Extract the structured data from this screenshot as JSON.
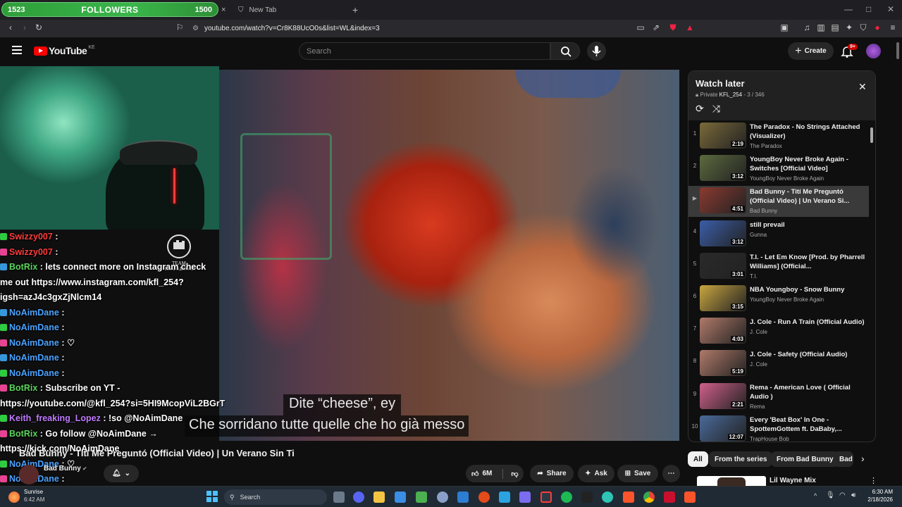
{
  "browser": {
    "followers_overlay": {
      "left_count": "1523",
      "label": "FOLLOWERS",
      "right_count": "1500"
    },
    "tab_new": "New Tab",
    "url": "youtube.com/watch?v=Cr8K88UcO0s&list=WL&index=3"
  },
  "header": {
    "logo_text": "YouTube",
    "logo_region": "KE",
    "search_placeholder": "Search",
    "create_label": "Create",
    "notif_count": "9+"
  },
  "video": {
    "caption_line1": "Dite “cheese”, ey",
    "caption_line2": "Che sorridano tutte quelle che ho già messo",
    "title": "Bad Bunny - Tití Me Preguntó (Official Video) | Un Verano Sin Ti",
    "channel": "Bad Bunny",
    "likes": "6M",
    "share": "Share",
    "ask": "Ask",
    "save": "Save"
  },
  "chat": [
    {
      "user": "Swizzy007",
      "msg": ": ",
      "color": "#ff3b3b"
    },
    {
      "user": "Swizzy007",
      "msg": ": ",
      "color": "#ff3b3b"
    },
    {
      "user": "BotRix",
      "msg": ": lets connect more on Instagram check",
      "color": "#5cd65c"
    },
    {
      "user": "",
      "msg": "me out https://www.instagram.com/kfl_254?",
      "color": "#fff"
    },
    {
      "user": "",
      "msg": "igsh=azJ4c3gxZjNlcm14",
      "color": "#fff"
    },
    {
      "user": "NoAimDane",
      "msg": ": ",
      "color": "#4aa3ff"
    },
    {
      "user": "NoAimDane",
      "msg": ": ",
      "color": "#4aa3ff"
    },
    {
      "user": "NoAimDane",
      "msg": ": ♡",
      "color": "#4aa3ff"
    },
    {
      "user": "NoAimDane",
      "msg": ": ",
      "color": "#4aa3ff"
    },
    {
      "user": "NoAimDane",
      "msg": ": ",
      "color": "#4aa3ff"
    },
    {
      "user": "BotRix",
      "msg": ": Subscribe on YT -",
      "color": "#5cd65c"
    },
    {
      "user": "",
      "msg": "https://youtube.com/@kfl_254?si=5HI9McopViL2BGrT",
      "color": "#fff"
    },
    {
      "user": "Keith_freaking_Lopez",
      "msg": ": !so @NoAimDane",
      "color": "#c07bff"
    },
    {
      "user": "BotRix",
      "msg": ": Go follow @NoAimDane →",
      "color": "#5cd65c"
    },
    {
      "user": "",
      "msg": "https://kick.com/NoAimDane",
      "color": "#fff"
    },
    {
      "user": "NoAimDane",
      "msg": ": ♡",
      "color": "#4aa3ff"
    },
    {
      "user": "NoAimDane",
      "msg": ": ",
      "color": "#4aa3ff"
    }
  ],
  "playlist": {
    "title": "Watch later",
    "privacy": "Private",
    "owner": "KFL_254",
    "position": "- 3 / 346",
    "items": [
      {
        "num": "1",
        "title": "The Paradox - No Strings Attached (Visualizer)",
        "channel": "The Paradox",
        "duration": "2:19",
        "thumb": "#7a6a3a"
      },
      {
        "num": "2",
        "title": "YoungBoy Never Broke Again - Switches [Official Video]",
        "channel": "YoungBoy Never Broke Again",
        "duration": "3:12",
        "thumb": "#5c6a3e"
      },
      {
        "num": "▶",
        "title": "Bad Bunny - Tití Me Preguntó (Official Video) | Un Verano Si...",
        "channel": "Bad Bunny",
        "duration": "4:51",
        "thumb": "#8a3a30"
      },
      {
        "num": "4",
        "title": "still prevail",
        "channel": "Gunna",
        "duration": "3:12",
        "thumb": "#3b5ea8"
      },
      {
        "num": "5",
        "title": "T.I. - Let Em Know [Prod. by Pharrell Williams] (Official...",
        "channel": "T.I.",
        "duration": "3:01",
        "thumb": "#2a2a2a"
      },
      {
        "num": "6",
        "title": "NBA Youngboy - Snow Bunny",
        "channel": "YoungBoy Never Broke Again",
        "duration": "3:15",
        "thumb": "#c9a640"
      },
      {
        "num": "7",
        "title": "J. Cole - Run A Train (Official Audio)",
        "channel": "J. Cole",
        "duration": "4:03",
        "thumb": "#b07a6a"
      },
      {
        "num": "8",
        "title": "J. Cole - Safety (Official Audio)",
        "channel": "J. Cole",
        "duration": "5:19",
        "thumb": "#b07a6a"
      },
      {
        "num": "9",
        "title": "Rema - American Love ( Official Audio )",
        "channel": "Rema",
        "duration": "2:21",
        "thumb": "#d0608a"
      },
      {
        "num": "10",
        "title": "Every 'Beat Box' In One - SpottemGottem ft. DaBaby,...",
        "channel": "TrapHouse Bob",
        "duration": "12:07",
        "thumb": "#4a6a9a"
      }
    ]
  },
  "chips": [
    "All",
    "From the series",
    "From Bad Bunny",
    "Bad"
  ],
  "next_item_title": "Lil Wayne Mix",
  "taskbar": {
    "weather": "Sunrise",
    "weather_time": "6:42 AM",
    "search": "Search",
    "clock_time": "6:30 AM",
    "clock_date": "2/18/2026"
  }
}
